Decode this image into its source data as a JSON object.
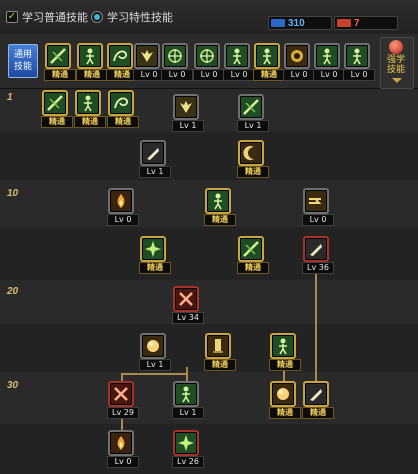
{
  "top": {
    "normal_skills_label": "学习普通技能",
    "trait_skills_label": "学习特性技能",
    "points_blue": "310",
    "points_red": "7"
  },
  "common_skills_label": "通用技能",
  "expand_label": "强学技能",
  "rows": [
    {
      "level": "1"
    },
    {
      "level": ""
    },
    {
      "level": "10"
    },
    {
      "level": ""
    },
    {
      "level": "20"
    },
    {
      "level": ""
    },
    {
      "level": "30"
    },
    {
      "level": ""
    }
  ],
  "hotbar": [
    {
      "name": "hotbar-slot-1",
      "tag": "精通",
      "icon": "slash"
    },
    {
      "name": "hotbar-slot-2",
      "tag": "精通",
      "icon": "figure"
    },
    {
      "name": "hotbar-slot-3",
      "tag": "精通",
      "icon": "swirl"
    },
    {
      "name": "hotbar-slot-4",
      "tag": "Lv 0",
      "icon": "wings"
    },
    {
      "name": "hotbar-slot-5",
      "tag": "Lv 0",
      "icon": "compass"
    },
    {
      "name": "hotbar-slot-6",
      "tag": "Lv 0",
      "icon": "compass"
    },
    {
      "name": "hotbar-slot-7",
      "tag": "Lv 0",
      "icon": "figure"
    },
    {
      "name": "hotbar-slot-8",
      "tag": "精通",
      "icon": "figure"
    },
    {
      "name": "hotbar-slot-9",
      "tag": "Lv 0",
      "icon": "eye"
    },
    {
      "name": "hotbar-slot-10",
      "tag": "Lv 0",
      "icon": "figure"
    },
    {
      "name": "hotbar-slot-11",
      "tag": "Lv 0",
      "icon": "figure"
    }
  ],
  "tree": [
    {
      "name": "skill-l1-a",
      "tag": "精通",
      "icon": "slash",
      "frame": "gold"
    },
    {
      "name": "skill-l1-b",
      "tag": "精通",
      "icon": "figure",
      "frame": "gold"
    },
    {
      "name": "skill-l1-c",
      "tag": "精通",
      "icon": "swirl",
      "frame": "gold"
    },
    {
      "name": "skill-l1-d",
      "tag": "Lv 1",
      "icon": "wings",
      "frame": "gray"
    },
    {
      "name": "skill-l1-e",
      "tag": "Lv 1",
      "icon": "slash",
      "frame": "gray"
    },
    {
      "name": "skill-l5-a",
      "tag": "Lv 1",
      "icon": "blade",
      "frame": "gray"
    },
    {
      "name": "skill-l5-b",
      "tag": "精通",
      "icon": "crescent",
      "frame": "gold"
    },
    {
      "name": "skill-l10-a",
      "tag": "Lv 0",
      "icon": "fire",
      "frame": "gray"
    },
    {
      "name": "skill-l10-b",
      "tag": "精通",
      "icon": "figure",
      "frame": "gold"
    },
    {
      "name": "skill-l10-c",
      "tag": "Lv 0",
      "icon": "dash",
      "frame": "gray"
    },
    {
      "name": "skill-l15-a",
      "tag": "精通",
      "icon": "burst",
      "frame": "gold"
    },
    {
      "name": "skill-l15-b",
      "tag": "精通",
      "icon": "slash",
      "frame": "gold"
    },
    {
      "name": "skill-l15-c",
      "tag": "Lv 36",
      "icon": "blade",
      "frame": "red"
    },
    {
      "name": "skill-l20-a",
      "tag": "Lv 34",
      "icon": "cross",
      "frame": "red"
    },
    {
      "name": "skill-l25-a",
      "tag": "Lv 1",
      "icon": "orb",
      "frame": "gray"
    },
    {
      "name": "skill-l25-b",
      "tag": "精通",
      "icon": "pillar",
      "frame": "gold"
    },
    {
      "name": "skill-l25-c",
      "tag": "精通",
      "icon": "figure",
      "frame": "gold"
    },
    {
      "name": "skill-l30-a",
      "tag": "Lv 29",
      "icon": "cross",
      "frame": "red"
    },
    {
      "name": "skill-l30-b",
      "tag": "Lv 1",
      "icon": "figure",
      "frame": "gray"
    },
    {
      "name": "skill-l30-c",
      "tag": "精通",
      "icon": "orb",
      "frame": "gold"
    },
    {
      "name": "skill-l30-d",
      "tag": "精通",
      "icon": "blade",
      "frame": "gold"
    },
    {
      "name": "skill-l35-a",
      "tag": "Lv 0",
      "icon": "fire",
      "frame": "gray"
    },
    {
      "name": "skill-l35-b",
      "tag": "Lv 26",
      "icon": "burst",
      "frame": "red"
    }
  ]
}
